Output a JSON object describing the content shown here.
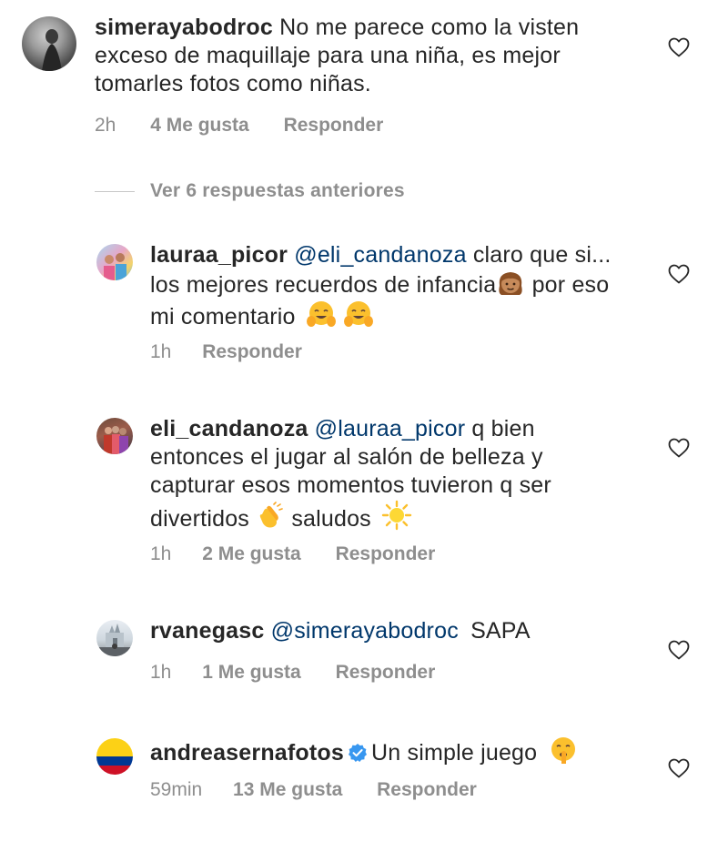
{
  "comments": [
    {
      "username": "simerayabodroc",
      "mention": "",
      "text": "No me parece como la visten exceso de maquillaje para una niña, es mejor tomarles fotos como niñas.",
      "time": "2h",
      "likes": "4 Me gusta",
      "reply": "Responder"
    },
    {
      "username": "lauraa_picor",
      "mention": "@eli_candanoza",
      "text_a": "claro que si... los mejores recuerdos de infancia",
      "text_b": "por eso mi comentario",
      "time": "1h",
      "likes": "",
      "reply": "Responder"
    },
    {
      "username": "eli_candanoza",
      "mention": "@lauraa_picor",
      "text_a": "q bien entonces el jugar al salón de belleza y capturar esos momentos tuvieron q ser divertidos",
      "text_b": "saludos",
      "time": "1h",
      "likes": "2 Me gusta",
      "reply": "Responder"
    },
    {
      "username": "rvanegasc",
      "mention": "@simerayabodroc",
      "text": "SAPA",
      "time": "1h",
      "likes": "1 Me gusta",
      "reply": "Responder"
    },
    {
      "username": "andreasernafotos",
      "mention": "",
      "text": "Un simple juego",
      "time": "59min",
      "likes": "13 Me gusta",
      "reply": "Responder"
    }
  ],
  "view_replies": "Ver 6 respuestas anteriores",
  "colors": {
    "text": "#262626",
    "secondary": "#8e8e8e",
    "mention": "#00376b",
    "verified": "#3897f0"
  },
  "icons": [
    "heart-outline-icon",
    "verified-badge-icon",
    "girl-emoji",
    "hugging-face-emoji",
    "clapping-hands-emoji",
    "sun-emoji",
    "shushing-face-emoji"
  ]
}
